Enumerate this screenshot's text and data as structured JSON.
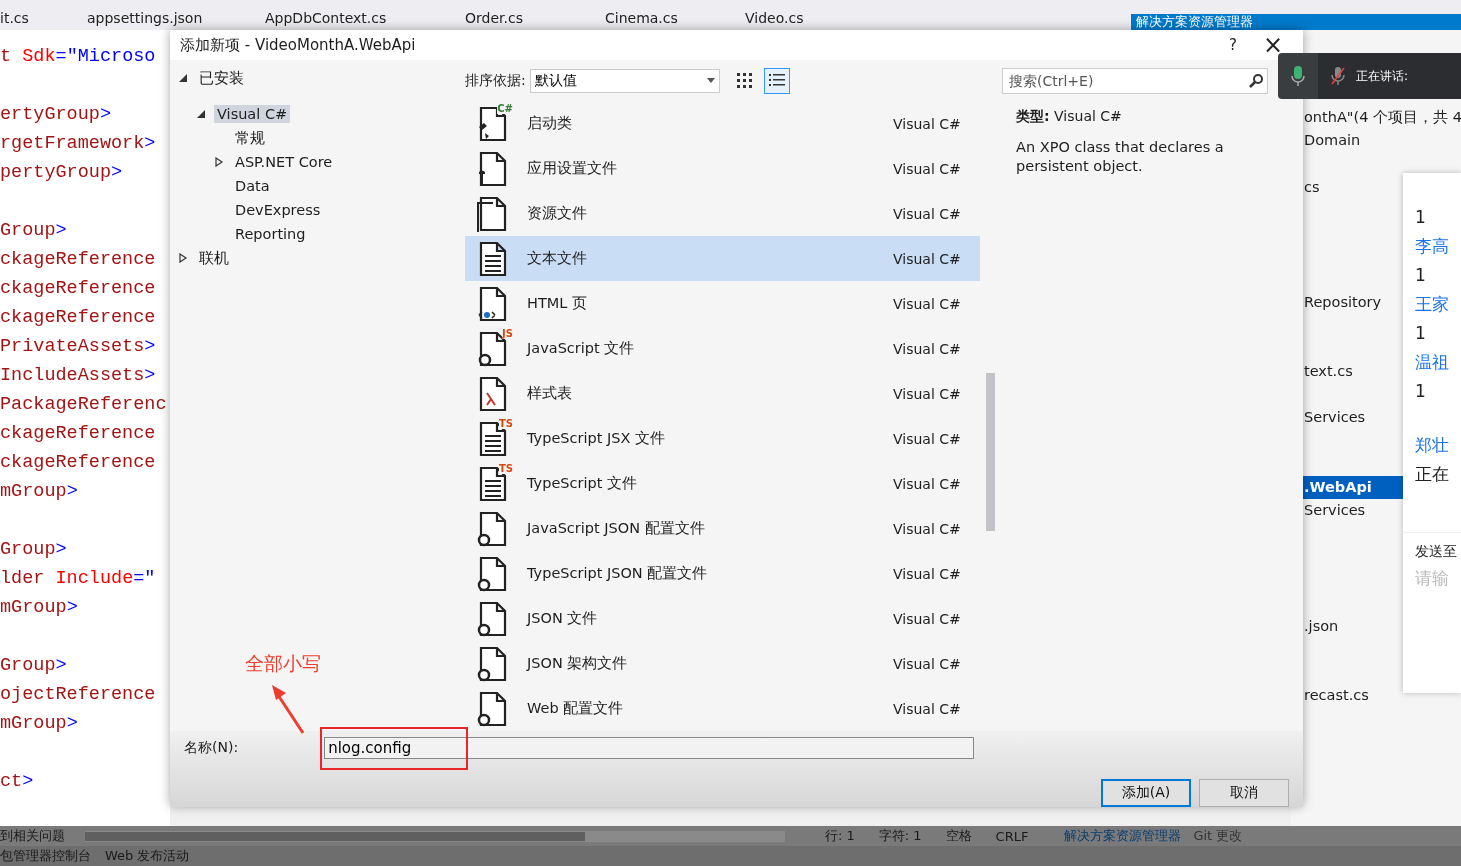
{
  "editor_tabs": [
    {
      "label": "it.cs",
      "selected": false
    },
    {
      "label": "appsettings.json",
      "selected": false
    },
    {
      "label": "AppDbContext.cs",
      "selected": false
    },
    {
      "label": "Order.cs",
      "selected": false
    },
    {
      "label": "Cinema.cs",
      "selected": false
    },
    {
      "label": "Video.cs",
      "selected": false
    }
  ],
  "explorer_header": "解决方案资源管理器",
  "code_lines": [
    {
      "kind": "code",
      "segments": [
        {
          "kind": "name",
          "t": "t "
        },
        {
          "kind": "attr",
          "t": "Sdk"
        },
        {
          "kind": "punct",
          "t": "="
        },
        {
          "kind": "value",
          "t": "\"Microso"
        }
      ]
    },
    {
      "kind": "blank"
    },
    {
      "kind": "code",
      "segments": [
        {
          "kind": "name",
          "t": "ertyGroup"
        },
        {
          "kind": "punct",
          "t": ">"
        }
      ]
    },
    {
      "kind": "code",
      "segments": [
        {
          "kind": "name",
          "t": "rgetFramework"
        },
        {
          "kind": "punct",
          "t": ">"
        }
      ]
    },
    {
      "kind": "code",
      "segments": [
        {
          "kind": "name",
          "t": "pertyGroup"
        },
        {
          "kind": "punct",
          "t": ">"
        }
      ]
    },
    {
      "kind": "blank"
    },
    {
      "kind": "code",
      "segments": [
        {
          "kind": "name",
          "t": "Group"
        },
        {
          "kind": "punct",
          "t": ">"
        }
      ]
    },
    {
      "kind": "code",
      "segments": [
        {
          "kind": "name",
          "t": "ckageReference"
        }
      ]
    },
    {
      "kind": "code",
      "segments": [
        {
          "kind": "name",
          "t": "ckageReference"
        }
      ]
    },
    {
      "kind": "code",
      "segments": [
        {
          "kind": "name",
          "t": "ckageReference"
        }
      ]
    },
    {
      "kind": "code",
      "segments": [
        {
          "kind": "name",
          "t": "PrivateAssets"
        },
        {
          "kind": "punct",
          "t": ">"
        }
      ]
    },
    {
      "kind": "code",
      "segments": [
        {
          "kind": "name",
          "t": "IncludeAssets"
        },
        {
          "kind": "punct",
          "t": ">"
        }
      ]
    },
    {
      "kind": "code",
      "segments": [
        {
          "kind": "name",
          "t": "PackageReferenc"
        }
      ]
    },
    {
      "kind": "code",
      "segments": [
        {
          "kind": "name",
          "t": "ckageReference"
        }
      ]
    },
    {
      "kind": "code",
      "segments": [
        {
          "kind": "name",
          "t": "ckageReference"
        }
      ]
    },
    {
      "kind": "code",
      "segments": [
        {
          "kind": "name",
          "t": "mGroup"
        },
        {
          "kind": "punct",
          "t": ">"
        }
      ]
    },
    {
      "kind": "blank"
    },
    {
      "kind": "code",
      "segments": [
        {
          "kind": "name",
          "t": "Group"
        },
        {
          "kind": "punct",
          "t": ">"
        }
      ]
    },
    {
      "kind": "code",
      "segments": [
        {
          "kind": "name",
          "t": "lder "
        },
        {
          "kind": "attr",
          "t": "Include"
        },
        {
          "kind": "punct",
          "t": "="
        },
        {
          "kind": "value",
          "t": "\""
        }
      ]
    },
    {
      "kind": "code",
      "segments": [
        {
          "kind": "name",
          "t": "mGroup"
        },
        {
          "kind": "punct",
          "t": ">"
        }
      ]
    },
    {
      "kind": "blank"
    },
    {
      "kind": "code",
      "segments": [
        {
          "kind": "name",
          "t": "Group"
        },
        {
          "kind": "punct",
          "t": ">"
        }
      ]
    },
    {
      "kind": "code",
      "segments": [
        {
          "kind": "name",
          "t": "ojectReference"
        }
      ]
    },
    {
      "kind": "code",
      "segments": [
        {
          "kind": "name",
          "t": "mGroup"
        },
        {
          "kind": "punct",
          "t": ">"
        }
      ]
    },
    {
      "kind": "blank"
    },
    {
      "kind": "code",
      "segments": [
        {
          "kind": "name",
          "t": "ct"
        },
        {
          "kind": "punct",
          "t": ">"
        }
      ]
    }
  ],
  "solution_explorer": [
    {
      "label": "onthA\"(4 个项目，共 4",
      "selected": false
    },
    {
      "label": "Domain",
      "selected": false
    },
    {
      "label": "cs",
      "selected": false
    },
    {
      "label": "Repository",
      "selected": false
    },
    {
      "label": "text.cs",
      "selected": false
    },
    {
      "label": "Services",
      "selected": false
    },
    {
      "label": ".WebApi",
      "selected": true
    },
    {
      "label": "Services",
      "selected": false
    },
    {
      "label": ".json",
      "selected": false
    },
    {
      "label": "recast.cs",
      "selected": false
    }
  ],
  "chat_panel": {
    "messages": [
      {
        "kind": "count",
        "text": "1"
      },
      {
        "kind": "name",
        "text": "李高"
      },
      {
        "kind": "count",
        "text": "1"
      },
      {
        "kind": "name",
        "text": "王家"
      },
      {
        "kind": "count",
        "text": "1"
      },
      {
        "kind": "name",
        "text": "温祖"
      },
      {
        "kind": "count",
        "text": "1"
      },
      {
        "kind": "name",
        "text": "郑壮"
      },
      {
        "kind": "status",
        "text": "正在"
      }
    ],
    "send_label": "发送至",
    "placeholder": "请输"
  },
  "voice_overlay": {
    "speaking_label": "正在讲话:",
    "muted": true
  },
  "dialog": {
    "title": "添加新项 - VideoMonthA.WebApi",
    "help": "?",
    "close": "×",
    "tree": [
      {
        "label": "已安装",
        "expanded": true,
        "selected": false,
        "children": [
          {
            "label": "Visual C#",
            "expanded": true,
            "selected": true,
            "children": [
              {
                "label": "常规",
                "selected": false
              },
              {
                "label": "ASP.NET Core",
                "expanded": false,
                "selected": false
              },
              {
                "label": "Data",
                "selected": false
              },
              {
                "label": "DevExpress",
                "selected": false
              },
              {
                "label": "Reporting",
                "selected": false
              }
            ]
          }
        ]
      },
      {
        "label": "联机",
        "expanded": false,
        "selected": false
      }
    ],
    "sort_label": "排序依据:",
    "sort_value": "默认值",
    "view_modes": [
      {
        "kind": "grid",
        "selected": false
      },
      {
        "kind": "list",
        "selected": true
      }
    ],
    "search_placeholder": "搜索(Ctrl+E)",
    "items": [
      {
        "name": "启动类",
        "language": "Visual C#",
        "kind": "class",
        "badge": "C#",
        "selected": false
      },
      {
        "name": "应用设置文件",
        "language": "Visual C#",
        "kind": "settings",
        "selected": false
      },
      {
        "name": "资源文件",
        "language": "Visual C#",
        "kind": "resource",
        "selected": false
      },
      {
        "name": "文本文件",
        "language": "Visual C#",
        "kind": "text",
        "selected": true
      },
      {
        "name": "HTML 页",
        "language": "Visual C#",
        "kind": "html",
        "selected": false
      },
      {
        "name": "JavaScript 文件",
        "language": "Visual C#",
        "kind": "script",
        "badge": "JS",
        "selected": false
      },
      {
        "name": "样式表",
        "language": "Visual C#",
        "kind": "stylesheet",
        "selected": false
      },
      {
        "name": "TypeScript JSX 文件",
        "language": "Visual C#",
        "kind": "text",
        "badge": "TS",
        "selected": false
      },
      {
        "name": "TypeScript 文件",
        "language": "Visual C#",
        "kind": "text",
        "badge": "TS",
        "selected": false
      },
      {
        "name": "JavaScript JSON 配置文件",
        "language": "Visual C#",
        "kind": "config",
        "selected": false
      },
      {
        "name": "TypeScript JSON 配置文件",
        "language": "Visual C#",
        "kind": "config",
        "selected": false
      },
      {
        "name": "JSON 文件",
        "language": "Visual C#",
        "kind": "config",
        "selected": false
      },
      {
        "name": "JSON 架构文件",
        "language": "Visual C#",
        "kind": "config",
        "selected": false
      },
      {
        "name": "Web 配置文件",
        "language": "Visual C#",
        "kind": "config",
        "selected": false
      }
    ],
    "details": {
      "type_label": "类型:",
      "type_value": "Visual C#",
      "description": "An XPO class that declares a persistent object."
    },
    "name_label": "名称(N):",
    "name_value": "nlog.config",
    "annotation": "全部小写",
    "buttons": [
      {
        "label": "添加(A)",
        "primary": true
      },
      {
        "label": "取消",
        "primary": false
      }
    ]
  },
  "status_bar": {
    "issues": "到相关问题",
    "line": "行: 1",
    "char": "字符: 1",
    "spaces": "空格",
    "eol": "CRLF",
    "tool_tabs": [
      {
        "label": "解决方案资源管理器",
        "selected": true
      },
      {
        "label": "Git 更改",
        "selected": false
      }
    ]
  },
  "bottom_tabs": [
    "包管理器控制台",
    "Web 发布活动"
  ]
}
